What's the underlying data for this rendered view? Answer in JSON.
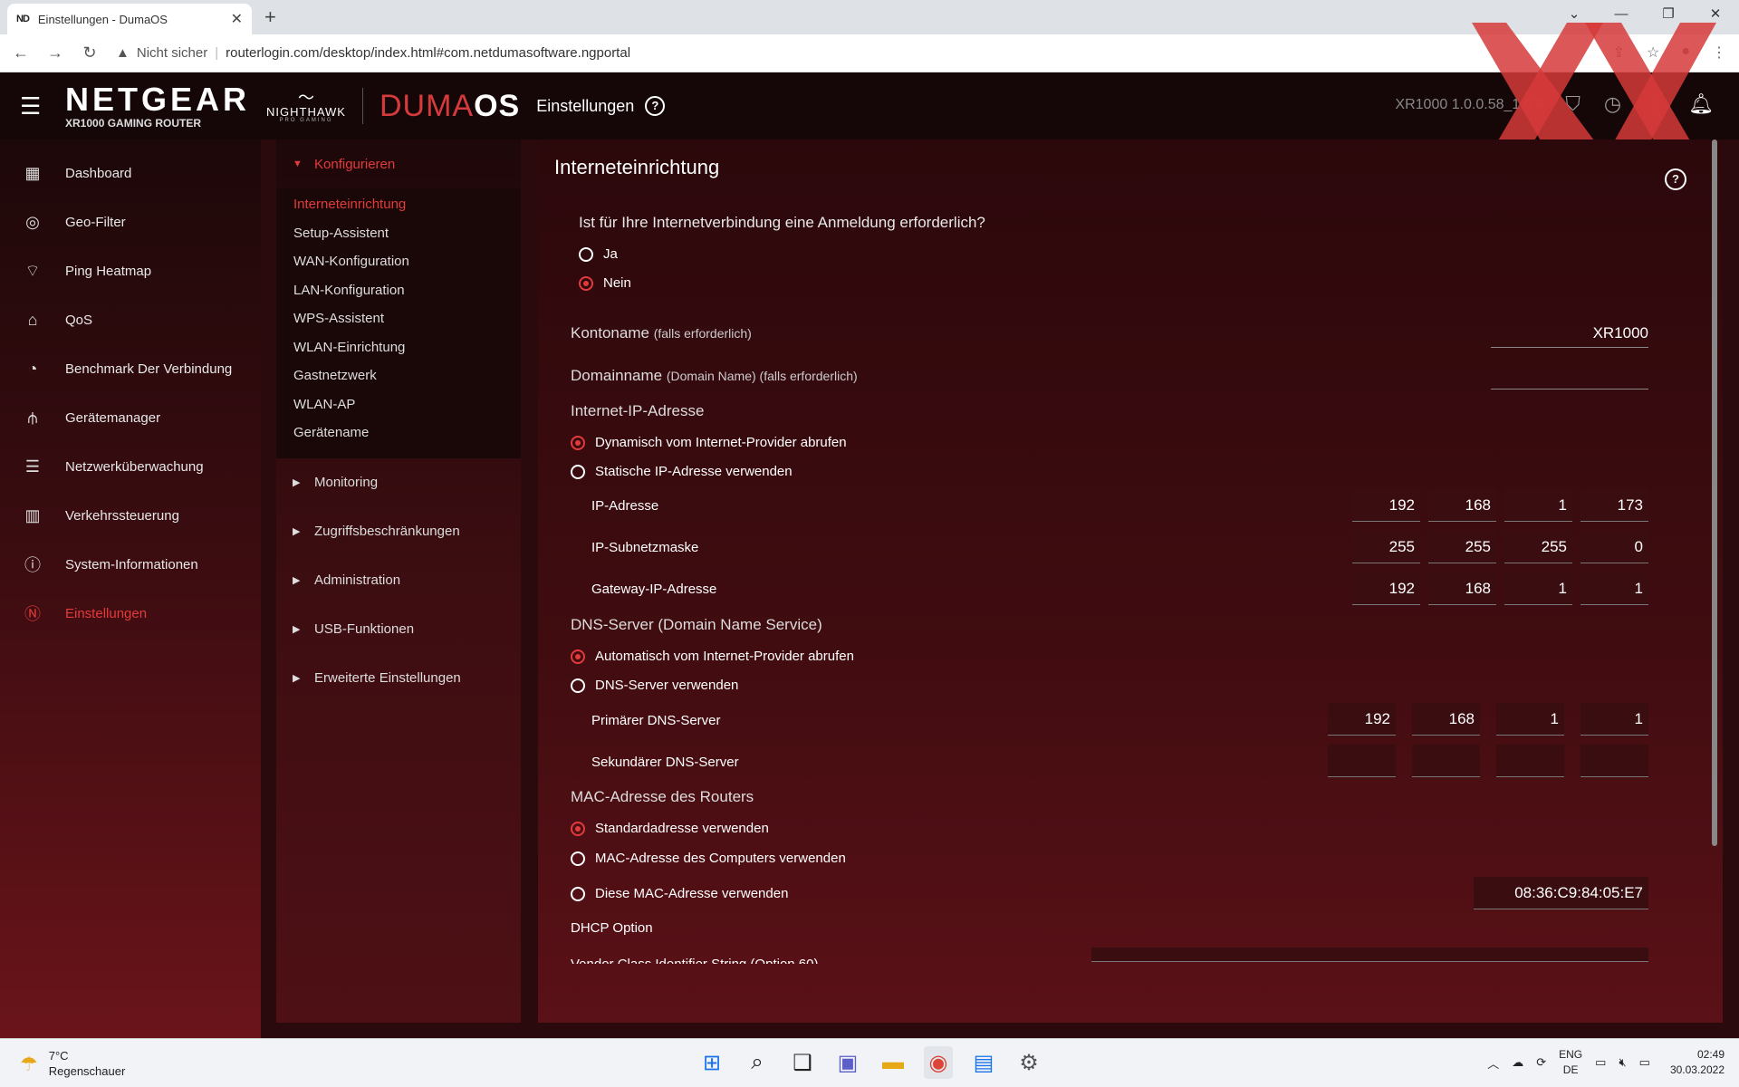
{
  "browser": {
    "tab_favicon": "ND",
    "tab_title": "Einstellungen - DumaOS",
    "tab_close": "✕",
    "new_tab": "+",
    "security_warning": "Nicht sicher",
    "url": "routerlogin.com/desktop/index.html#com.netdumasoftware.ngportal"
  },
  "header": {
    "brand": "NETGEAR",
    "model": "XR1000 GAMING ROUTER",
    "nighthawk": "NIGHTHAWK",
    "nighthawk_sub": "PRO GAMING",
    "duma": "DUMA",
    "os": "OS",
    "title": "Einstellungen",
    "version": "XR1000 1.0.0.58_1.0.4"
  },
  "sidebar": {
    "items": [
      {
        "label": "Dashboard",
        "icon": "dashboard-icon"
      },
      {
        "label": "Geo-Filter",
        "icon": "geo-filter-icon"
      },
      {
        "label": "Ping Heatmap",
        "icon": "ping-heatmap-icon"
      },
      {
        "label": "QoS",
        "icon": "qos-icon"
      },
      {
        "label": "Benchmark Der Verbindung",
        "icon": "benchmark-icon"
      },
      {
        "label": "Gerätemanager",
        "icon": "device-manager-icon"
      },
      {
        "label": "Netzwerküberwachung",
        "icon": "network-monitor-icon"
      },
      {
        "label": "Verkehrssteuerung",
        "icon": "traffic-control-icon"
      },
      {
        "label": "System-Informationen",
        "icon": "system-info-icon"
      },
      {
        "label": "Einstellungen",
        "icon": "settings-logo-icon",
        "active": true
      }
    ]
  },
  "subnav": {
    "open_group": "Konfigurieren",
    "sub_items": [
      "Interneteinrichtung",
      "Setup-Assistent",
      "WAN-Konfiguration",
      "LAN-Konfiguration",
      "WPS-Assistent",
      "WLAN-Einrichtung",
      "Gastnetzwerk",
      "WLAN-AP",
      "Gerätename"
    ],
    "groups": [
      "Monitoring",
      "Zugriffsbeschränkungen",
      "Administration",
      "USB-Funktionen",
      "Erweiterte Einstellungen"
    ]
  },
  "main": {
    "title": "Interneteinrichtung",
    "login_question": "Ist für Ihre Internetverbindung eine Anmeldung erforderlich?",
    "login_yes": "Ja",
    "login_no": "Nein",
    "account_name_label": "Kontoname",
    "account_name_hint": "(falls erforderlich)",
    "account_name_value": "XR1000",
    "domain_name_label": "Domainname",
    "domain_name_hint": "(Domain Name) (falls erforderlich)",
    "domain_name_value": "",
    "ip_section": "Internet-IP-Adresse",
    "ip_dynamic": "Dynamisch vom Internet-Provider abrufen",
    "ip_static": "Statische IP-Adresse verwenden",
    "ip_address_label": "IP-Adresse",
    "ip_address": [
      "192",
      "168",
      "1",
      "173"
    ],
    "subnet_label": "IP-Subnetzmaske",
    "subnet": [
      "255",
      "255",
      "255",
      "0"
    ],
    "gateway_label": "Gateway-IP-Adresse",
    "gateway": [
      "192",
      "168",
      "1",
      "1"
    ],
    "dns_section": "DNS-Server (Domain Name Service)",
    "dns_auto": "Automatisch vom Internet-Provider abrufen",
    "dns_manual": "DNS-Server verwenden",
    "dns_primary_label": "Primärer DNS-Server",
    "dns_primary": [
      "192",
      "168",
      "1",
      "1"
    ],
    "dns_secondary_label": "Sekundärer DNS-Server",
    "dns_secondary": [
      "",
      "",
      "",
      ""
    ],
    "mac_section": "MAC-Adresse des Routers",
    "mac_default": "Standardadresse verwenden",
    "mac_computer": "MAC-Adresse des Computers verwenden",
    "mac_custom": "Diese MAC-Adresse verwenden",
    "mac_value": "08:36:C9:84:05:E7",
    "dhcp_label": "DHCP Option",
    "vendor_class_label": "Vendor Class Identifier String (Option 60)"
  },
  "taskbar": {
    "temp": "7°C",
    "weather": "Regenschauer",
    "lang_top": "ENG",
    "lang_bottom": "DE",
    "time": "02:49",
    "date": "30.03.2022"
  },
  "colors": {
    "accent": "#e23b3b",
    "header_bg": "#150708",
    "content_bg": "#3f0c10"
  }
}
